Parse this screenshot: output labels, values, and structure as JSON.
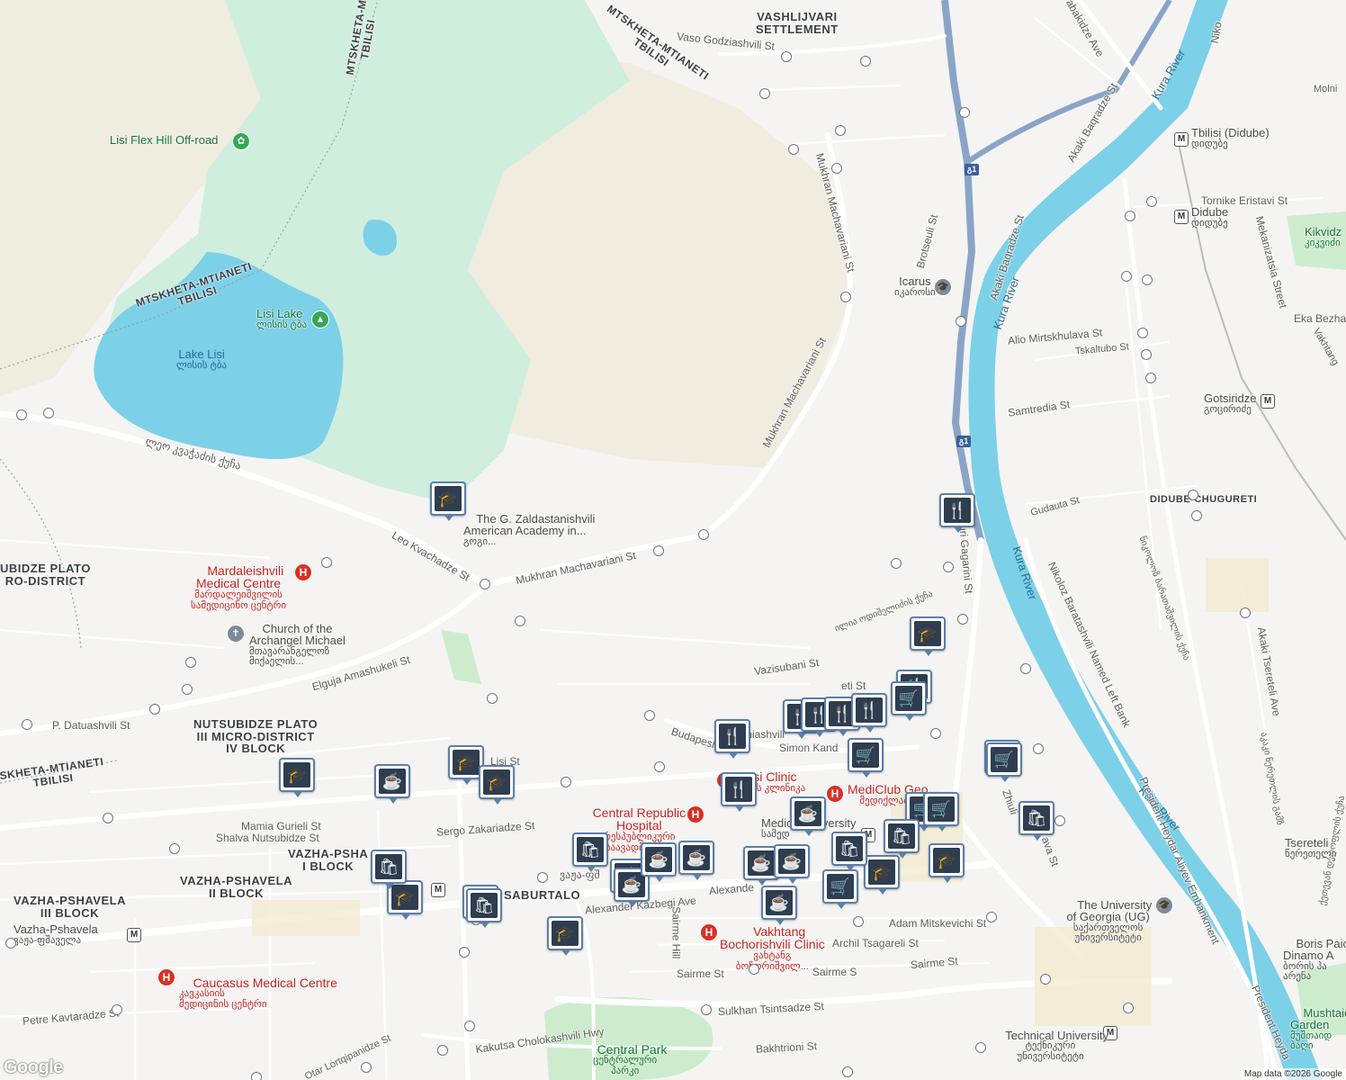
{
  "map": {
    "water_color": "#7cd0e8",
    "park_color": "#cdeccd",
    "hill_color": "#f0ece0",
    "road_color": "#ffffff",
    "highway_color": "#8aa4c8",
    "hospital_color": "#d93025",
    "attribution": "Map data ©2026 Google",
    "logo": "Google"
  },
  "areas": [
    {
      "id": "vashlijvari",
      "text": "VASHLIJVARI\nSETTLEMENT"
    },
    {
      "id": "nutsubidze-plato-micro",
      "text": "UBIDZE PLATO\nRO-DISTRICT"
    },
    {
      "id": "nutsubidze-plato-iii",
      "text": "NUTSUBIDZE PLATO\nIII MICRO-DISTRICT\nIV BLOCK"
    },
    {
      "id": "vazha-pshavela-i",
      "text": "VAZHA-PSHA\nI BLOCK"
    },
    {
      "id": "vazha-pshavela-ii",
      "text": "VAZHA-PSHAVELA\nII BLOCK"
    },
    {
      "id": "vazha-pshavela-iii",
      "text": "VAZHA-PSHAVELA\nIII BLOCK"
    },
    {
      "id": "saburtalo",
      "text": "SABURTALO"
    },
    {
      "id": "didube-chugureti",
      "text": "DIDUBE-CHUGURETI"
    },
    {
      "id": "mtskheta-1",
      "text": "MTSKHETA-MTIANETI\nTBILISI"
    },
    {
      "id": "mtskheta-2",
      "text": "MTSKHETA-MTIANETI\nTBILISI"
    },
    {
      "id": "mtskheta-3",
      "text": "MTSKHETA-M\nTBILISI"
    },
    {
      "id": "mtskheta-4",
      "text": "SKHETA-MTIANETI\nTBILISI"
    }
  ],
  "water_labels": [
    {
      "id": "lake-lisi",
      "name": "Lake Lisi",
      "local": "ლისის ტბა"
    },
    {
      "id": "kura-1",
      "name": "Kura River"
    },
    {
      "id": "kura-2",
      "name": "Kura River"
    },
    {
      "id": "kura-3",
      "name": "Kura River"
    },
    {
      "id": "kura-4",
      "name": "Kura River"
    }
  ],
  "roads": [
    {
      "id": "vaso",
      "name": "Vaso Godziashvili St"
    },
    {
      "id": "mukhran-1",
      "name": "Mukhran Machavariani St"
    },
    {
      "id": "mukhran-2",
      "name": "Mukhran Machavariani St"
    },
    {
      "id": "mukhran-3",
      "name": "Mukhran Machavariani St"
    },
    {
      "id": "brotseuli",
      "name": "Brotseuli St"
    },
    {
      "id": "leo",
      "name": "Leo Kvachadze St"
    },
    {
      "id": "leo-geo",
      "name": "ლეო კვაჭაძის ქუჩა"
    },
    {
      "id": "elguja",
      "name": "Elguja Amashukeli St"
    },
    {
      "id": "datuashvili",
      "name": "P. Datuashvili St"
    },
    {
      "id": "lisi",
      "name": "Lisi St"
    },
    {
      "id": "mamia",
      "name": "Mamia Gurieli St"
    },
    {
      "id": "shalva",
      "name": "Shalva Nutsubidze St"
    },
    {
      "id": "sergo",
      "name": "Sergo Zakariadze St"
    },
    {
      "id": "kazbegi",
      "name": "Alexander Kazbegi Ave"
    },
    {
      "id": "kazbegi-2",
      "name": "Alexande"
    },
    {
      "id": "vazha-geo",
      "name": "ვაჟა-ფშ"
    },
    {
      "id": "budapesht",
      "name": "Budapesht"
    },
    {
      "id": "simon",
      "name": "Simon Kand"
    },
    {
      "id": "vazisubani",
      "name": "Vazisubani St"
    },
    {
      "id": "oniashvili",
      "name": "Oniashvili"
    },
    {
      "id": "sairme-hill",
      "name": "Sairme Hill"
    },
    {
      "id": "sairme-1",
      "name": "Sairme St"
    },
    {
      "id": "sairme-2",
      "name": "Sairme S"
    },
    {
      "id": "sairme-3",
      "name": "Sairme St"
    },
    {
      "id": "adam",
      "name": "Adam Mitskevichi St"
    },
    {
      "id": "archil",
      "name": "Archil Tsagareli St"
    },
    {
      "id": "sulkhan",
      "name": "Sulkhan Tsintsadze St"
    },
    {
      "id": "kakutsa",
      "name": "Kakutsa Cholokashvili Hwy"
    },
    {
      "id": "bakhtrioni",
      "name": "Bakhtrioni St"
    },
    {
      "id": "otar",
      "name": "Otar Lortqipanidze St"
    },
    {
      "id": "petre",
      "name": "Petre Kavtaradze St"
    },
    {
      "id": "gagarini",
      "name": "uri Gagarini St"
    },
    {
      "id": "oda-geo",
      "name": "ილია ოდიშელიძის ქუჩა"
    },
    {
      "id": "zhiuli",
      "name": "Zhiuli"
    },
    {
      "id": "zhiuli-2",
      "name": "ava St"
    },
    {
      "id": "baratashvili",
      "name": "Nikoloz Baratashvili Named Left Bank"
    },
    {
      "id": "heydar",
      "name": "President Heydar Aliyev Embankment"
    },
    {
      "id": "heydar-2",
      "name": "President Heyda"
    },
    {
      "id": "akaki-baqradze-1",
      "name": "Akaki Baqradze St"
    },
    {
      "id": "akaki-baqradze-2",
      "name": "Akaki Baqradze St"
    },
    {
      "id": "akaki-tsereteli",
      "name": "Akaki Tsereteli Ave"
    },
    {
      "id": "tornike",
      "name": "Tornike Eristavi St"
    },
    {
      "id": "mekanizatsia",
      "name": "Mekanizatsia Street"
    },
    {
      "id": "alio",
      "name": "Alio Mirtskhulava St"
    },
    {
      "id": "tskaltubo",
      "name": "Tskaltubo St"
    },
    {
      "id": "samtredia",
      "name": "Samtredia St"
    },
    {
      "id": "gudauta",
      "name": "Gudauta St"
    },
    {
      "id": "nikolo",
      "name": "Niko"
    },
    {
      "id": "molni",
      "name": "Molni"
    },
    {
      "id": "eka",
      "name": "Eka Bezha"
    },
    {
      "id": "vakhtang",
      "name": "Vakhtang"
    },
    {
      "id": "abakidze",
      "name": "abakidze Ave"
    },
    {
      "id": "geo-right-1",
      "name": "ნიკოლოზ ბარათაშვილის ქუჩა"
    },
    {
      "id": "geo-right-2",
      "name": "აკაკი წერეთლის გამზ"
    },
    {
      "id": "geo-right-3",
      "name": "ქეთევან დედოფლის ქუჩა"
    },
    {
      "id": "eti",
      "name": "eti St"
    }
  ],
  "shields": [
    {
      "id": "s1",
      "text": "გ1"
    },
    {
      "id": "s2",
      "text": "გ1"
    }
  ],
  "places": [
    {
      "id": "lisi-flex",
      "name": "Lisi Flex Hill Off-road",
      "icon": "park-icon"
    },
    {
      "id": "lisi-lake",
      "name": "Lisi Lake",
      "local": "ლისის ტბა",
      "icon": "tree-icon"
    },
    {
      "id": "icarus",
      "name": "Icarus",
      "local": "იკაროსი",
      "icon": "school-icon"
    },
    {
      "id": "academy",
      "name": "The G. Zaldastanishvili\nAmerican Academy in...",
      "local": "გოგი...",
      "icon": "school-icon"
    },
    {
      "id": "church",
      "name": "Church of the\nArchangel Michael",
      "local": "მთავარანგელოზ\nმიქაელის...",
      "icon": "church-icon"
    },
    {
      "id": "ug",
      "name": "The University\nof Georgia (UG)",
      "local": "საქართველოს\nუნივერსიტეტი",
      "icon": "school-icon"
    },
    {
      "id": "boris",
      "name": "Boris Paich\nDinamo A",
      "local": "ბორის პა\nარენა",
      "icon": "stadium-icon"
    },
    {
      "id": "mushtaidi",
      "name": "Mushtaidi\nGarden",
      "local": "მუშთაიდ\nბაღი",
      "icon": "park-icon"
    },
    {
      "id": "kikvidze",
      "name": "Kikvidz",
      "local": "კიკვიძი",
      "icon": "park-icon"
    },
    {
      "id": "central-park",
      "name": "Central Park",
      "local": "ცენტრალური\nპარკი",
      "icon": "park-icon"
    },
    {
      "id": "medical-university",
      "name": "Medical University",
      "local": "სამედ",
      "icon": "metro-icon"
    }
  ],
  "hospitals": [
    {
      "id": "mardaleishvili",
      "name": "Mardaleishvili\nMedical Centre",
      "local": "მარდალეიშვილის\nსამედიცინო ცენტრი"
    },
    {
      "id": "central-republican",
      "name": "Central Republican\nHospital",
      "local": "რესპუბლიკური\nსაავადმყოფო"
    },
    {
      "id": "aversi",
      "name": "ersi Clinic",
      "local": "ერსის კლინიკა"
    },
    {
      "id": "mediclub",
      "name": "MediClub Geo",
      "local": "მედიქლაბ ჯ"
    },
    {
      "id": "vakhtang",
      "name": "Vakhtang\nBochorishvili Clinic",
      "local": "ვახტანგ\nბოჩორიშვილ..."
    },
    {
      "id": "caucasus",
      "name": "Caucasus Medical Centre",
      "local": "კავკასიის\nმედიცინის ცენტრი"
    }
  ],
  "metros": [
    {
      "id": "tbilisi-didube",
      "name": "Tbilisi (Didube)",
      "local": "დიდუბე"
    },
    {
      "id": "didube",
      "name": "Didube",
      "local": "დიდუბე"
    },
    {
      "id": "gotsiridze",
      "name": "Gotsiridze",
      "local": "გოცირიძე"
    },
    {
      "id": "vazha-pshavela",
      "name": "Vazha-Pshavela",
      "local": "ვაჟა-ფშაველა"
    },
    {
      "id": "tsereteli",
      "name": "Tsereteli",
      "local": "წერეთელი"
    },
    {
      "id": "technical-university",
      "name": "Technical University",
      "local": "ტექნიკური\nუნივერსიტეტი"
    },
    {
      "id": "delisi",
      "name": "",
      "local": ""
    }
  ],
  "markers": [
    {
      "id": "m-school-academy",
      "icon": "graduation-cap-icon"
    },
    {
      "id": "m-restaurant-gagarini",
      "icon": "fork-knife-icon"
    },
    {
      "id": "m-school-gagarini",
      "icon": "graduation-cap-icon"
    },
    {
      "id": "m-restaurant-1",
      "icon": "fork-knife-icon"
    },
    {
      "id": "m-restaurant-2",
      "icon": "fork-knife-icon"
    },
    {
      "id": "m-restaurant-3",
      "icon": "fork-knife-icon"
    },
    {
      "id": "m-restaurant-4",
      "icon": "fork-knife-icon"
    },
    {
      "id": "m-restaurant-5",
      "icon": "fork-knife-icon"
    },
    {
      "id": "m-restaurant-6",
      "icon": "fork-knife-icon"
    },
    {
      "id": "m-restaurant-7",
      "icon": "fork-knife-icon"
    },
    {
      "id": "m-cart-1",
      "icon": "shopping-cart-icon"
    },
    {
      "id": "m-cart-2",
      "icon": "shopping-cart-icon"
    },
    {
      "id": "m-cart-3",
      "icon": "shopping-cart-icon"
    },
    {
      "id": "m-cart-4",
      "icon": "shopping-cart-icon"
    },
    {
      "id": "m-cart-5",
      "icon": "shopping-cart-icon"
    },
    {
      "id": "m-cart-6",
      "icon": "shopping-cart-icon"
    },
    {
      "id": "m-cart-7",
      "icon": "shopping-cart-icon"
    },
    {
      "id": "m-school-1",
      "icon": "graduation-cap-icon"
    },
    {
      "id": "m-school-2",
      "icon": "graduation-cap-icon"
    },
    {
      "id": "m-school-3",
      "icon": "graduation-cap-icon"
    },
    {
      "id": "m-school-4",
      "icon": "graduation-cap-icon"
    },
    {
      "id": "m-school-5",
      "icon": "graduation-cap-icon"
    },
    {
      "id": "m-school-6",
      "icon": "graduation-cap-icon"
    },
    {
      "id": "m-school-7",
      "icon": "graduation-cap-icon"
    },
    {
      "id": "m-cafe-1",
      "icon": "coffee-cup-icon"
    },
    {
      "id": "m-cafe-2",
      "icon": "coffee-cup-icon"
    },
    {
      "id": "m-cafe-3",
      "icon": "coffee-cup-icon"
    },
    {
      "id": "m-cafe-4",
      "icon": "coffee-cup-icon"
    },
    {
      "id": "m-cafe-5",
      "icon": "coffee-cup-icon"
    },
    {
      "id": "m-cafe-6",
      "icon": "coffee-cup-icon"
    },
    {
      "id": "m-cafe-7",
      "icon": "coffee-cup-icon"
    },
    {
      "id": "m-cafe-8",
      "icon": "coffee-cup-icon"
    },
    {
      "id": "m-cafe-9",
      "icon": "coffee-cup-icon"
    },
    {
      "id": "m-bag-1",
      "icon": "shopping-bag-icon"
    },
    {
      "id": "m-bag-2",
      "icon": "shopping-bag-icon"
    },
    {
      "id": "m-bag-3",
      "icon": "shopping-bag-icon"
    },
    {
      "id": "m-bag-4",
      "icon": "shopping-bag-icon"
    },
    {
      "id": "m-bag-5",
      "icon": "shopping-bag-icon"
    },
    {
      "id": "m-bag-6",
      "icon": "shopping-bag-icon"
    },
    {
      "id": "m-bag-7",
      "icon": "shopping-bag-icon"
    }
  ]
}
